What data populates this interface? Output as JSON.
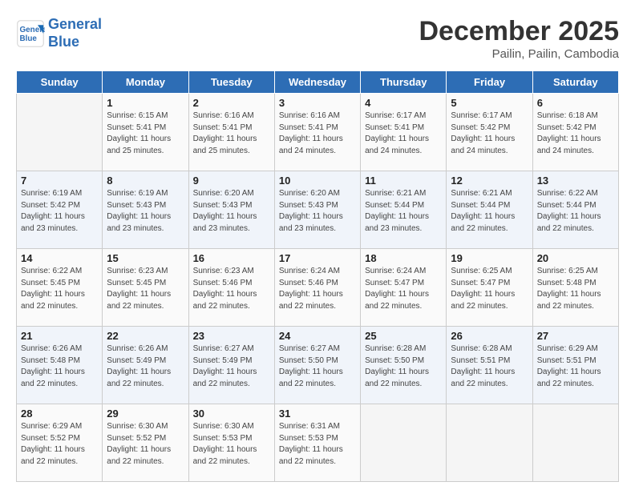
{
  "header": {
    "logo_line1": "General",
    "logo_line2": "Blue",
    "month": "December 2025",
    "location": "Pailin, Pailin, Cambodia"
  },
  "weekdays": [
    "Sunday",
    "Monday",
    "Tuesday",
    "Wednesday",
    "Thursday",
    "Friday",
    "Saturday"
  ],
  "weeks": [
    [
      {
        "day": "",
        "empty": true
      },
      {
        "day": "1",
        "sunrise": "6:15 AM",
        "sunset": "5:41 PM",
        "daylight": "11 hours and 25 minutes."
      },
      {
        "day": "2",
        "sunrise": "6:16 AM",
        "sunset": "5:41 PM",
        "daylight": "11 hours and 25 minutes."
      },
      {
        "day": "3",
        "sunrise": "6:16 AM",
        "sunset": "5:41 PM",
        "daylight": "11 hours and 24 minutes."
      },
      {
        "day": "4",
        "sunrise": "6:17 AM",
        "sunset": "5:41 PM",
        "daylight": "11 hours and 24 minutes."
      },
      {
        "day": "5",
        "sunrise": "6:17 AM",
        "sunset": "5:42 PM",
        "daylight": "11 hours and 24 minutes."
      },
      {
        "day": "6",
        "sunrise": "6:18 AM",
        "sunset": "5:42 PM",
        "daylight": "11 hours and 24 minutes."
      }
    ],
    [
      {
        "day": "7",
        "sunrise": "6:19 AM",
        "sunset": "5:42 PM",
        "daylight": "11 hours and 23 minutes."
      },
      {
        "day": "8",
        "sunrise": "6:19 AM",
        "sunset": "5:43 PM",
        "daylight": "11 hours and 23 minutes."
      },
      {
        "day": "9",
        "sunrise": "6:20 AM",
        "sunset": "5:43 PM",
        "daylight": "11 hours and 23 minutes."
      },
      {
        "day": "10",
        "sunrise": "6:20 AM",
        "sunset": "5:43 PM",
        "daylight": "11 hours and 23 minutes."
      },
      {
        "day": "11",
        "sunrise": "6:21 AM",
        "sunset": "5:44 PM",
        "daylight": "11 hours and 23 minutes."
      },
      {
        "day": "12",
        "sunrise": "6:21 AM",
        "sunset": "5:44 PM",
        "daylight": "11 hours and 22 minutes."
      },
      {
        "day": "13",
        "sunrise": "6:22 AM",
        "sunset": "5:44 PM",
        "daylight": "11 hours and 22 minutes."
      }
    ],
    [
      {
        "day": "14",
        "sunrise": "6:22 AM",
        "sunset": "5:45 PM",
        "daylight": "11 hours and 22 minutes."
      },
      {
        "day": "15",
        "sunrise": "6:23 AM",
        "sunset": "5:45 PM",
        "daylight": "11 hours and 22 minutes."
      },
      {
        "day": "16",
        "sunrise": "6:23 AM",
        "sunset": "5:46 PM",
        "daylight": "11 hours and 22 minutes."
      },
      {
        "day": "17",
        "sunrise": "6:24 AM",
        "sunset": "5:46 PM",
        "daylight": "11 hours and 22 minutes."
      },
      {
        "day": "18",
        "sunrise": "6:24 AM",
        "sunset": "5:47 PM",
        "daylight": "11 hours and 22 minutes."
      },
      {
        "day": "19",
        "sunrise": "6:25 AM",
        "sunset": "5:47 PM",
        "daylight": "11 hours and 22 minutes."
      },
      {
        "day": "20",
        "sunrise": "6:25 AM",
        "sunset": "5:48 PM",
        "daylight": "11 hours and 22 minutes."
      }
    ],
    [
      {
        "day": "21",
        "sunrise": "6:26 AM",
        "sunset": "5:48 PM",
        "daylight": "11 hours and 22 minutes."
      },
      {
        "day": "22",
        "sunrise": "6:26 AM",
        "sunset": "5:49 PM",
        "daylight": "11 hours and 22 minutes."
      },
      {
        "day": "23",
        "sunrise": "6:27 AM",
        "sunset": "5:49 PM",
        "daylight": "11 hours and 22 minutes."
      },
      {
        "day": "24",
        "sunrise": "6:27 AM",
        "sunset": "5:50 PM",
        "daylight": "11 hours and 22 minutes."
      },
      {
        "day": "25",
        "sunrise": "6:28 AM",
        "sunset": "5:50 PM",
        "daylight": "11 hours and 22 minutes."
      },
      {
        "day": "26",
        "sunrise": "6:28 AM",
        "sunset": "5:51 PM",
        "daylight": "11 hours and 22 minutes."
      },
      {
        "day": "27",
        "sunrise": "6:29 AM",
        "sunset": "5:51 PM",
        "daylight": "11 hours and 22 minutes."
      }
    ],
    [
      {
        "day": "28",
        "sunrise": "6:29 AM",
        "sunset": "5:52 PM",
        "daylight": "11 hours and 22 minutes."
      },
      {
        "day": "29",
        "sunrise": "6:30 AM",
        "sunset": "5:52 PM",
        "daylight": "11 hours and 22 minutes."
      },
      {
        "day": "30",
        "sunrise": "6:30 AM",
        "sunset": "5:53 PM",
        "daylight": "11 hours and 22 minutes."
      },
      {
        "day": "31",
        "sunrise": "6:31 AM",
        "sunset": "5:53 PM",
        "daylight": "11 hours and 22 minutes."
      },
      {
        "day": "",
        "empty": true
      },
      {
        "day": "",
        "empty": true
      },
      {
        "day": "",
        "empty": true
      }
    ]
  ]
}
